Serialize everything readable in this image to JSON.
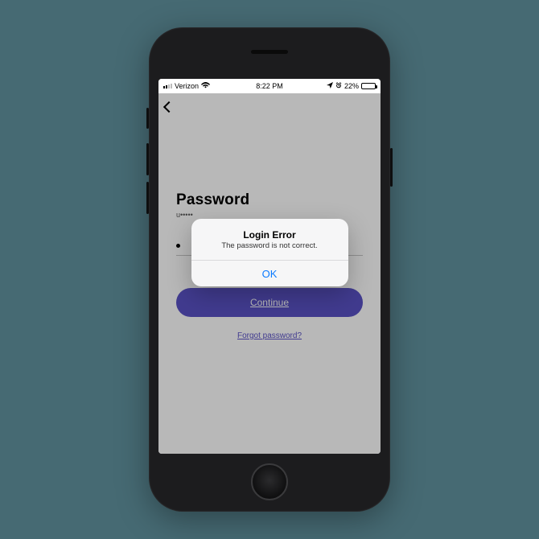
{
  "status_bar": {
    "carrier": "Verizon",
    "time": "8:22 PM",
    "battery_percent": "22%",
    "wifi_icon": "wifi",
    "location_icon": "location",
    "alarm_icon": "alarm"
  },
  "nav": {
    "back_icon": "chevron-left"
  },
  "page": {
    "title": "Password",
    "subtitle": "u•••••",
    "continue_label": "Continue",
    "forgot_label": "Forgot password?"
  },
  "alert": {
    "title": "Login Error",
    "message": "The password is not correct.",
    "ok_label": "OK"
  },
  "colors": {
    "accent": "#5a52c7",
    "ios_link": "#0a7aff"
  }
}
